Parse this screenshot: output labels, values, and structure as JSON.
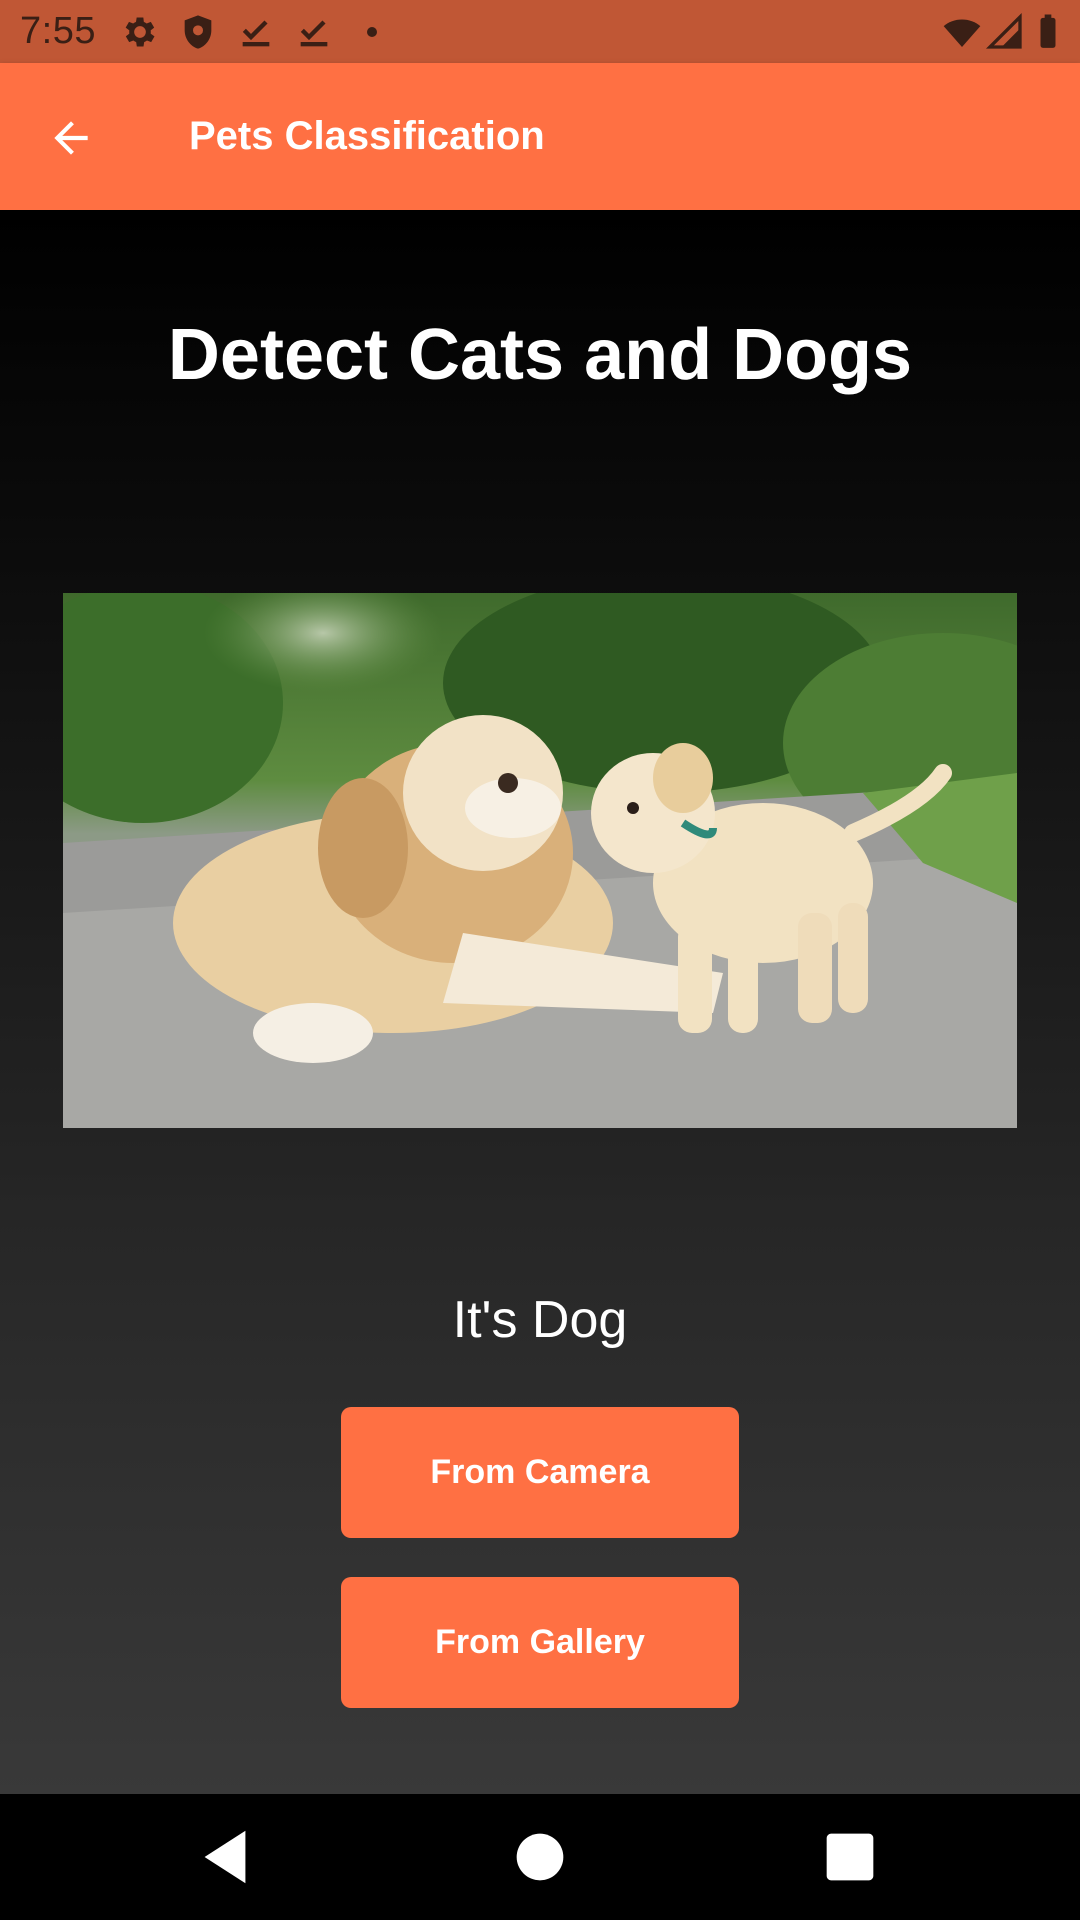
{
  "status_bar": {
    "time": "7:55",
    "icons": [
      "gear-icon",
      "shield-icon",
      "download-done-icon",
      "download-done-icon",
      "dot-icon",
      "wifi-icon",
      "signal-icon",
      "battery-icon"
    ]
  },
  "app_bar": {
    "title": "Pets Classification",
    "background": "#ff7043"
  },
  "main": {
    "headline": "Detect Cats and Dogs",
    "photo_description": "dog-photo",
    "result_text": "It's Dog",
    "camera_button_label": "From Camera",
    "gallery_button_label": "From Gallery"
  },
  "nav_bar": {
    "icons": [
      "back-triangle-icon",
      "home-circle-icon",
      "recents-square-icon"
    ]
  },
  "colors": {
    "accent": "#ff7043",
    "status_bar": "#c05735",
    "text": "#ffffff"
  }
}
